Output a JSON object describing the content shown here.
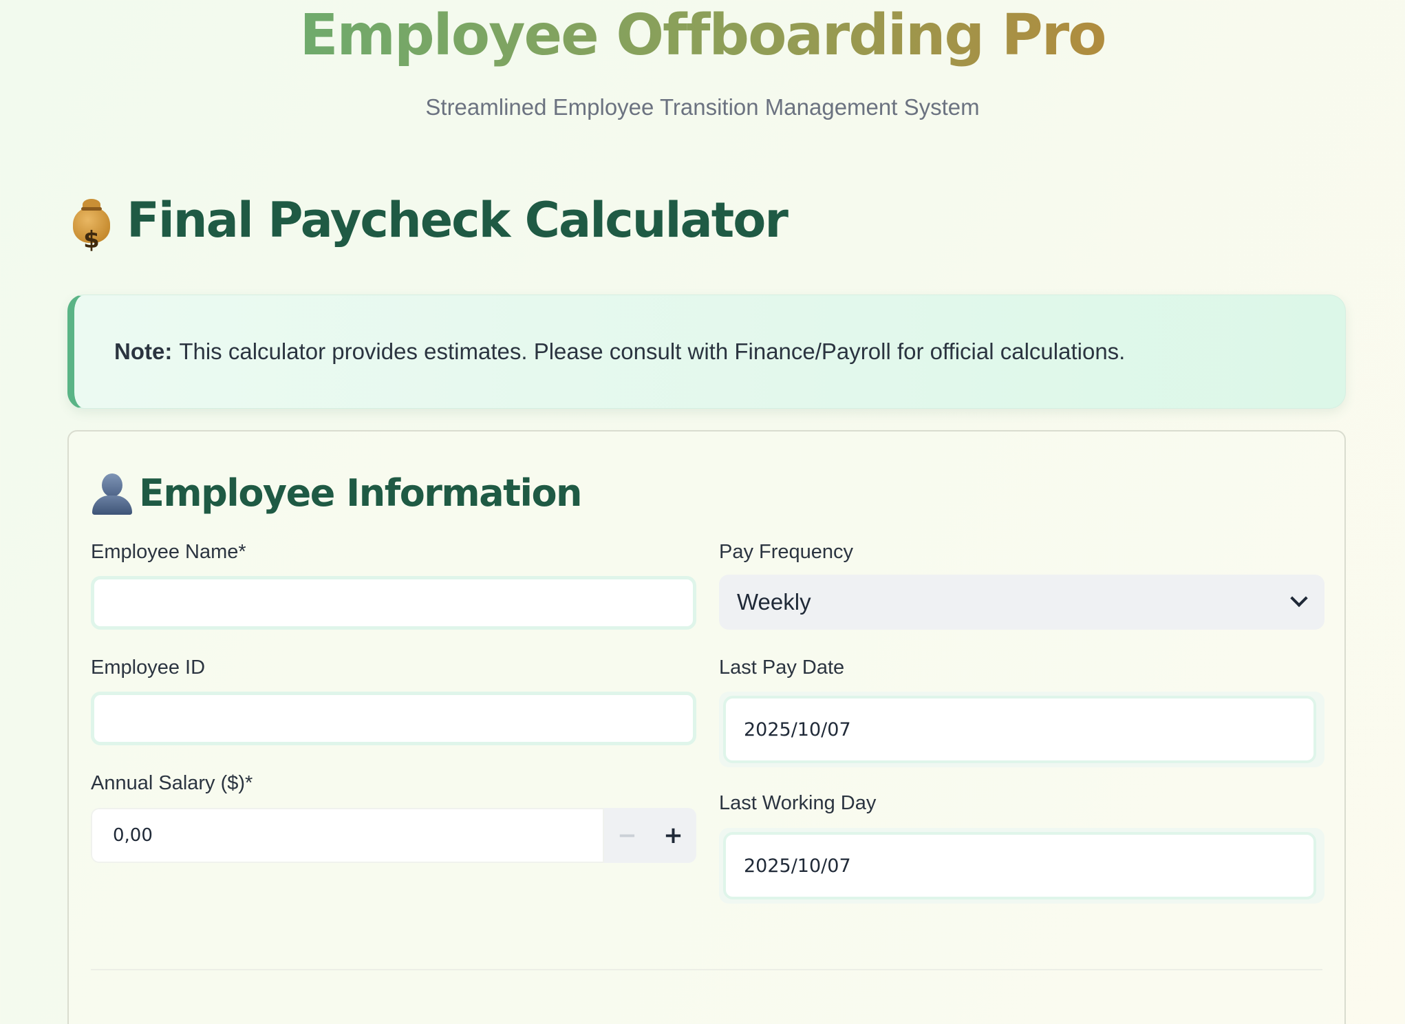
{
  "header": {
    "title": "Employee Offboarding Pro",
    "subtitle": "Streamlined Employee Transition Management System"
  },
  "section": {
    "title": "Final Paycheck Calculator",
    "icon": "money-bag-icon"
  },
  "note": {
    "label": "Note:",
    "text": "This calculator provides estimates. Please consult with Finance/Payroll for official calculations."
  },
  "employee_info": {
    "title": "Employee Information",
    "icon": "person-silhouette-icon",
    "fields": {
      "name": {
        "label": "Employee Name*",
        "value": "",
        "placeholder": ""
      },
      "id": {
        "label": "Employee ID",
        "value": "",
        "placeholder": ""
      },
      "salary": {
        "label": "Annual Salary ($)*",
        "value": "0,00",
        "decrement": "−",
        "increment": "+"
      },
      "pay_frequency": {
        "label": "Pay Frequency",
        "value": "Weekly"
      },
      "last_pay_date": {
        "label": "Last Pay Date",
        "value": "2025/10/07"
      },
      "last_working_day": {
        "label": "Last Working Day",
        "value": "2025/10/07"
      }
    }
  },
  "colors": {
    "heading_green": "#1f5a44",
    "accent_green": "#5ab486",
    "title_gradient_start": "#6faa6c",
    "title_gradient_end": "#b08c3e"
  }
}
